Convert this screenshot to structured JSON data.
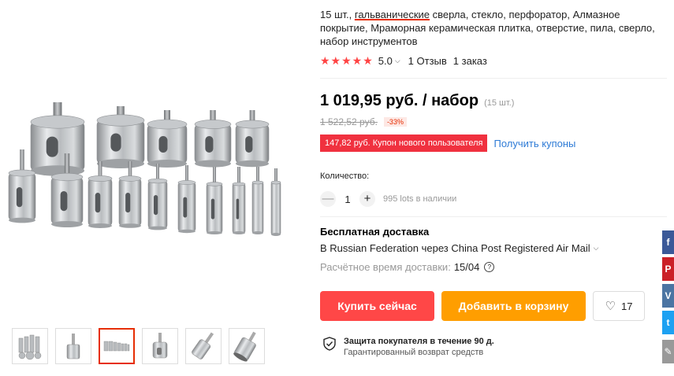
{
  "product": {
    "title_prefix": "15 шт., ",
    "title_highlight": "гальванические",
    "title_suffix": " сверла, стекло, перфоратор, Алмазное покрытие, Мраморная керамическая плитка, отверстие, пила, сверло, набор инструментов"
  },
  "rating": {
    "stars": "★★★★★",
    "score": "5.0",
    "reviews": "1 Отзыв",
    "orders": "1 заказ"
  },
  "price": {
    "current": "1 019,95 руб. / набор",
    "per_unit": "(15 шт.)",
    "old": "1 522,52 руб.",
    "discount": "-33%"
  },
  "coupon": {
    "badge": "147,82 руб. Купон нового пользователя",
    "link": "Получить купоны"
  },
  "quantity": {
    "label": "Количество:",
    "minus": "—",
    "value": "1",
    "plus": "+",
    "stock": "995 lots в наличии"
  },
  "shipping": {
    "title": "Бесплатная доставка",
    "route": "В Russian Federation через China Post Registered Air Mail",
    "eta_label": "Расчётное время доставки:",
    "eta_value": "15/04"
  },
  "actions": {
    "buy_now": "Купить сейчас",
    "add_to_cart": "Добавить в корзину",
    "wishlist_count": "17"
  },
  "protection": {
    "title": "Защита покупателя в течение 90 д.",
    "subtitle": "Гарантированный возврат средств"
  },
  "social": {
    "facebook": "f",
    "pinterest": "P",
    "vk": "V",
    "twitter": "t"
  },
  "colors": {
    "accent": "#ff4747",
    "cart": "#ff9e00",
    "link": "#2e7bd6",
    "star": "#ff4444"
  },
  "thumbnails": [
    "drill-set-fan",
    "single-bit",
    "full-set-row",
    "bit-closeup",
    "bit-angled",
    "bit-cutting-edge"
  ],
  "thumbnail_active_index": 2
}
